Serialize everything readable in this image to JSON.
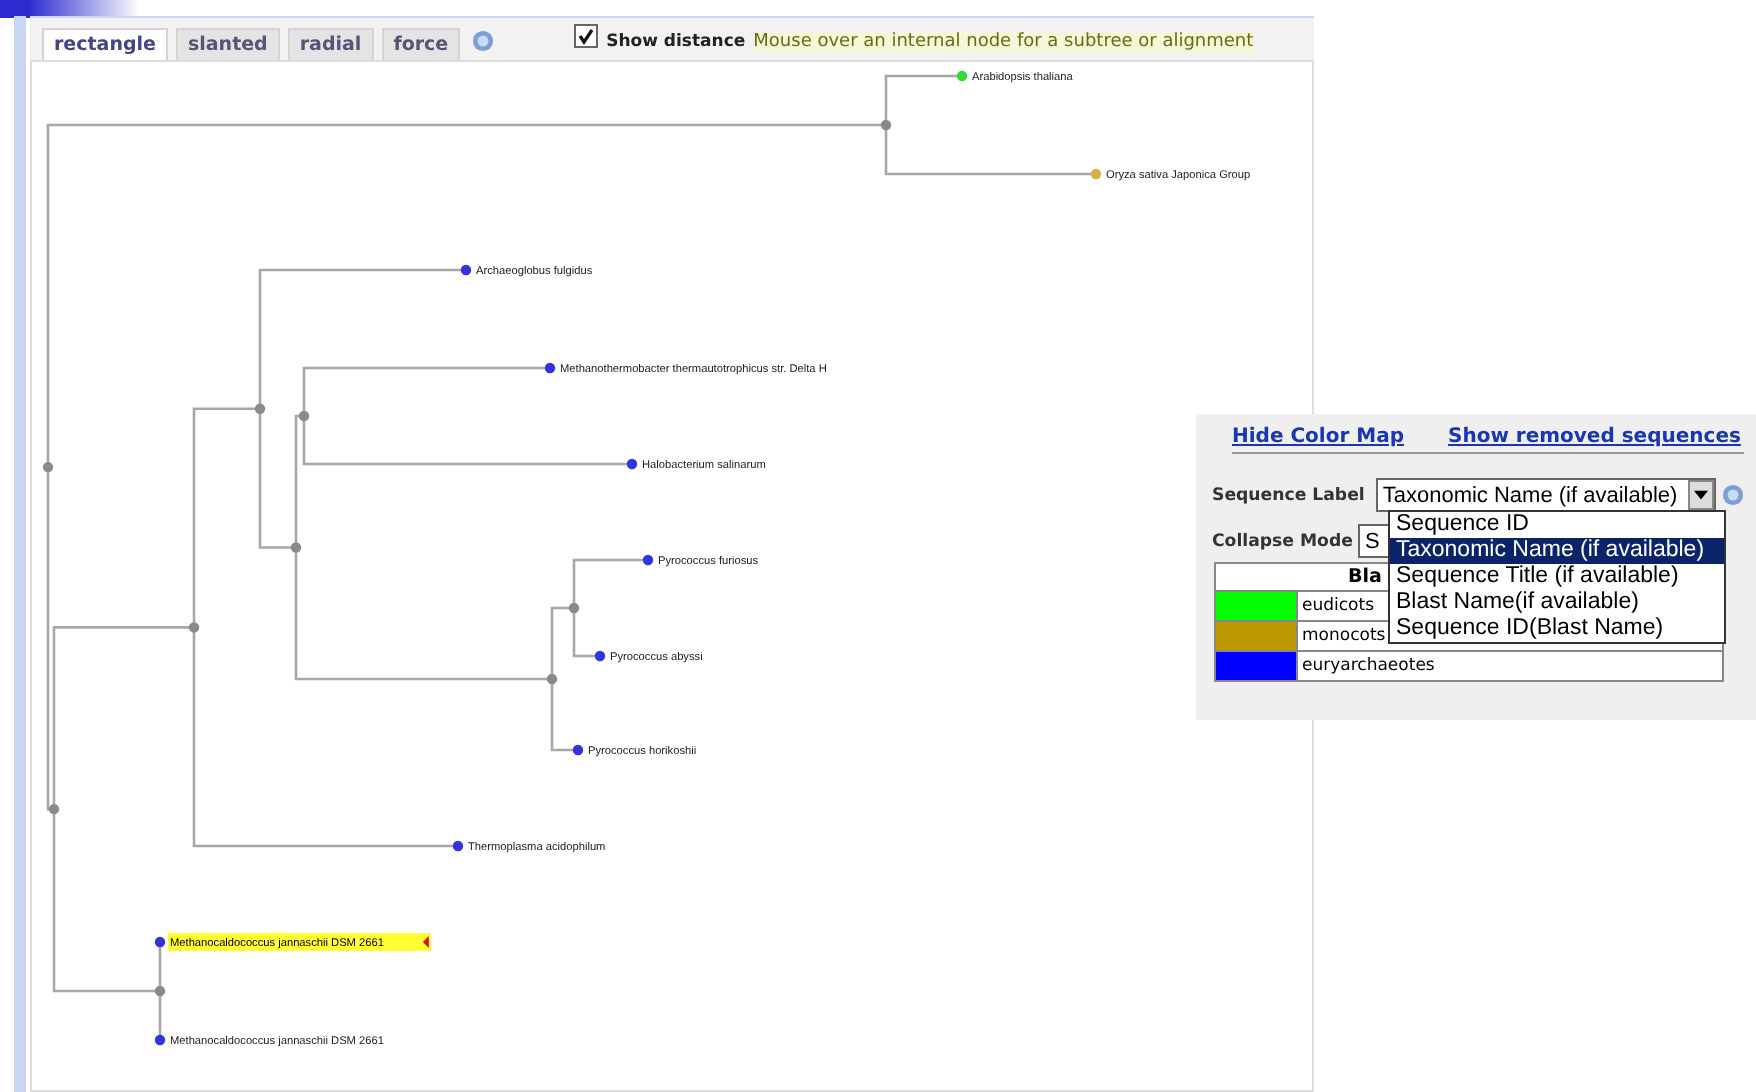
{
  "tabs": [
    {
      "label": "rectangle",
      "selected": true
    },
    {
      "label": "slanted",
      "selected": false
    },
    {
      "label": "radial",
      "selected": false
    },
    {
      "label": "force",
      "selected": false
    }
  ],
  "show_distance": {
    "label": "Show distance",
    "checked": true
  },
  "hint": "Mouse over an internal node for a subtree or alignment",
  "tree": {
    "children": [
      {
        "children": [
          {
            "label": "Arabidopsis thaliana",
            "color": "#33dd33",
            "highlighted": false
          },
          {
            "label": "Oryza sativa Japonica Group",
            "color": "#d4b24a",
            "highlighted": false
          }
        ]
      },
      {
        "children": [
          {
            "children": [
              {
                "children": [
                  {
                    "label": "Archaeoglobus fulgidus",
                    "color": "#3333dd",
                    "highlighted": false
                  },
                  {
                    "children": [
                      {
                        "children": [
                          {
                            "label": "Methanothermobacter thermautotrophicus str. Delta H",
                            "color": "#3333dd",
                            "highlighted": false
                          },
                          {
                            "label": "Halobacterium salinarum",
                            "color": "#3333dd",
                            "highlighted": false
                          }
                        ]
                      },
                      {
                        "children": [
                          {
                            "children": [
                              {
                                "label": "Pyrococcus furiosus",
                                "color": "#3333dd",
                                "highlighted": false
                              },
                              {
                                "label": "Pyrococcus abyssi",
                                "color": "#3333dd",
                                "highlighted": false
                              }
                            ]
                          },
                          {
                            "label": "Pyrococcus horikoshii",
                            "color": "#3333dd",
                            "highlighted": false
                          }
                        ]
                      }
                    ]
                  }
                ]
              },
              {
                "label": "Thermoplasma acidophilum",
                "color": "#3333dd",
                "highlighted": false
              }
            ]
          },
          {
            "children": [
              {
                "label": "Methanocaldococcus jannaschii DSM 2661",
                "color": "#3333dd",
                "highlighted": true
              },
              {
                "label": "Methanocaldococcus jannaschii DSM 2661",
                "color": "#3333dd",
                "highlighted": false
              }
            ]
          }
        ]
      }
    ]
  },
  "color_panel": {
    "links": [
      "Hide Color Map",
      "Show removed sequences"
    ],
    "sequence_label": {
      "label": "Sequence Label",
      "value": "Taxonomic Name (if available)",
      "options": [
        {
          "label": "Sequence ID",
          "selected": false
        },
        {
          "label": "Taxonomic Name (if available)",
          "selected": true
        },
        {
          "label": "Sequence Title (if available)",
          "selected": false
        },
        {
          "label": "Blast Name(if available)",
          "selected": false
        },
        {
          "label": "Sequence ID(Blast Name)",
          "selected": false
        }
      ]
    },
    "collapse_mode": {
      "label": "Collapse Mode",
      "value": "S"
    },
    "color_map": {
      "header": "Bla",
      "rows": [
        {
          "name": "eudicots",
          "color": "#00ff00"
        },
        {
          "name": "monocots",
          "color": "#bf9900"
        },
        {
          "name": "euryarchaeotes",
          "color": "#0000ff"
        }
      ]
    }
  }
}
